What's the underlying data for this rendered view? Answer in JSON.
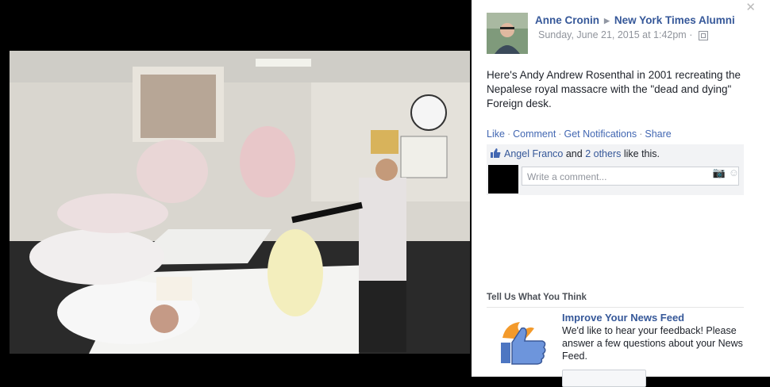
{
  "post": {
    "author": "Anne Cronin",
    "group": "New York Times Alumni",
    "timestamp": "Sunday, June 21, 2015 at 1:42pm",
    "text": "Here's Andy Andrew Rosenthal in 2001 recreating the Nepalese royal massacre with the \"dead and dying\" Foreign desk."
  },
  "actions": {
    "like": "Like",
    "comment": "Comment",
    "notifications": "Get Notifications",
    "share": "Share"
  },
  "likes": {
    "name": "Angel Franco",
    "and": "and",
    "others": "2 others",
    "suffix": "like this."
  },
  "comment": {
    "placeholder": "Write a comment..."
  },
  "promo": {
    "header": "Tell Us What You Think",
    "title": "Improve Your News Feed",
    "text": "We'd like to hear your feedback! Please answer a few questions about your News Feed."
  },
  "icons": {
    "close": "close-icon",
    "privacy": "globe-icon",
    "like": "thumbs-up-icon",
    "camera": "camera-icon",
    "emoji": "emoji-icon",
    "feedback": "feedback-thumb-icon"
  },
  "colors": {
    "link": "#365899",
    "action": "#4267b2",
    "background": "#000000"
  }
}
